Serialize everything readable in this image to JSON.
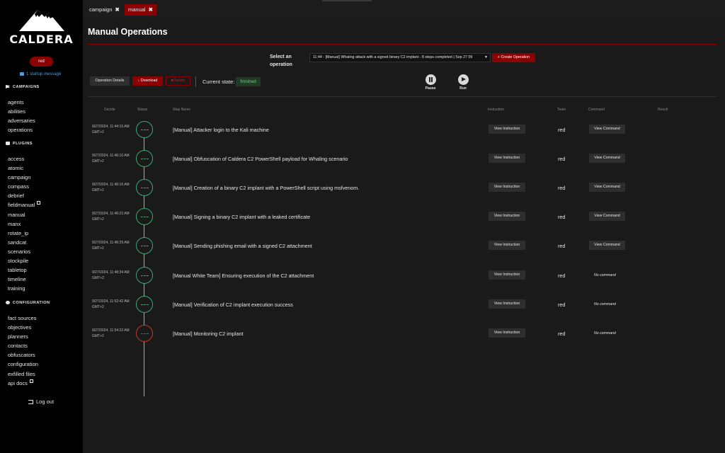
{
  "sidebar": {
    "logo_text": "CALDERA",
    "user": "red",
    "startup_message": "1 startup message",
    "sections": {
      "campaigns": "CAMPAIGNS",
      "plugins": "PLUGINS",
      "configuration": "CONFIGURATION"
    },
    "campaign_items": [
      "agents",
      "abilities",
      "adversaries",
      "operations"
    ],
    "plugin_items": [
      "access",
      "atomic",
      "campaign",
      "compass",
      "debrief",
      "fieldmanual",
      "manual",
      "manx",
      "rotate_ip",
      "sandcat",
      "scenarios",
      "stockpile",
      "tabletop",
      "timeline",
      "training"
    ],
    "config_items": [
      "fact sources",
      "objectives",
      "planners",
      "contacts",
      "obfuscators",
      "configuration",
      "exfilled files",
      "api docs"
    ],
    "logout": "Log out"
  },
  "tabs": [
    {
      "label": "campaign",
      "close": "✖",
      "active": false
    },
    {
      "label": "manual",
      "close": "✖",
      "active": true
    }
  ],
  "main": {
    "title": "Manual Operations",
    "select_label": "Select an operation",
    "selected_operation": "11:44 - [Manual] Whaling attack with a signed binary C2 implant - 8 steps completed | Sep 27 09",
    "create_button": "Create Operation",
    "details_button": "Operation Details",
    "download_button": "Download",
    "delete_button": "Delete",
    "state_label": "Current state:",
    "state_value": "finished",
    "pause_label": "Pause",
    "run_label": "Run"
  },
  "table": {
    "headers": {
      "decide": "Decide",
      "status": "Status",
      "step_name": "Step Name",
      "instruction": "Instruction",
      "team": "Team",
      "command": "Command",
      "result": "Result"
    },
    "instruction_label": "View Instruction",
    "command_label": "View Command",
    "no_command_label": "No command",
    "rows": [
      {
        "date": "9/27/2024, 11:44:15 AM GMT+2",
        "step": "[Manual] Attacker login to the Kali machine",
        "team": "red",
        "has_command": true,
        "status": "success"
      },
      {
        "date": "9/27/2024, 11:46:10 AM GMT+2",
        "step": "[Manual] Obfuscation of Caldera C2 PowerShell payload for Whaling scenario",
        "team": "red",
        "has_command": true,
        "status": "success"
      },
      {
        "date": "9/27/2024, 11:46:16 AM GMT+2",
        "step": "[Manual] Creation of a binary C2 implant with a PowerShell script using msfvenom.",
        "team": "red",
        "has_command": true,
        "status": "success"
      },
      {
        "date": "9/27/2024, 11:46:22 AM GMT+2",
        "step": "[Manual] Signing a binary C2 implant with a leaked certificate",
        "team": "red",
        "has_command": true,
        "status": "success"
      },
      {
        "date": "9/27/2024, 11:46:29 AM GMT+2",
        "step": "[Manual] Sending phishing email with a signed C2 attachment",
        "team": "red",
        "has_command": true,
        "status": "success"
      },
      {
        "date": "9/27/2024, 11:48:34 AM GMT+2",
        "step": "[Manual White Team] Ensuring execution of the C2 attachment",
        "team": "red",
        "has_command": false,
        "status": "success"
      },
      {
        "date": "9/27/2024, 11:52:42 AM GMT+2",
        "step": "[Manual] Verification of C2 implant execution success",
        "team": "red",
        "has_command": false,
        "status": "success"
      },
      {
        "date": "9/27/2024, 11:54:22 AM GMT+2",
        "step": "[Manual] Monitoring C2 implant",
        "team": "red",
        "has_command": false,
        "status": "error"
      }
    ]
  }
}
